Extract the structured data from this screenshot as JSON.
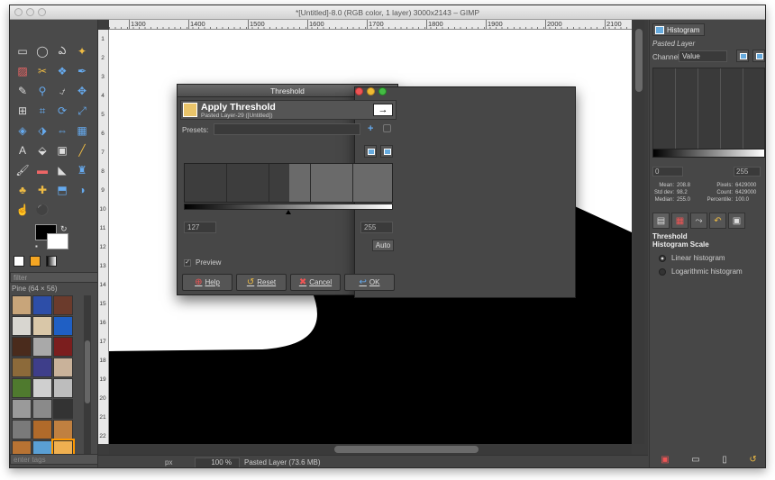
{
  "window": {
    "title": "*[Untitled]-8.0 (RGB color, 1 layer) 3000x2143 – GIMP"
  },
  "ruler": {
    "h_ticks": [
      "1300",
      "1400",
      "1500",
      "1600",
      "1700",
      "1800",
      "1900",
      "2000",
      "2100"
    ],
    "v_ticks": [
      "1",
      "2",
      "3",
      "4",
      "5",
      "6",
      "7",
      "8",
      "9",
      "10",
      "11",
      "12",
      "13",
      "14",
      "15",
      "16",
      "17",
      "18",
      "19",
      "20",
      "21",
      "22"
    ]
  },
  "toolbox": {
    "brush_filter": "filter",
    "pattern_title": "Pine (64 × 56)",
    "tag_placeholder": "enter tags",
    "tools": [
      "rect-select",
      "ellipse-select",
      "free-select",
      "fuzzy-select",
      "select-by-color",
      "scissors",
      "foreground-select",
      "paths",
      "color-picker",
      "zoom",
      "measure",
      "move",
      "align",
      "crop",
      "rotate",
      "scale",
      "shear",
      "perspective",
      "flip",
      "cage",
      "text",
      "bucket-fill",
      "blend",
      "pencil",
      "paintbrush",
      "eraser",
      "airbrush",
      "ink",
      "clone",
      "heal",
      "perspective-clone",
      "blur",
      "smudge",
      "dodge-burn"
    ],
    "tool_glyphs": [
      "▭",
      "◯",
      "ఎ",
      "✦",
      "▨",
      "✂",
      "❖",
      "✒",
      "✎",
      "⚲",
      "⍻",
      "✥",
      "⊞",
      "⌗",
      "⟳",
      "⤢",
      "◈",
      "⬗",
      "⇔",
      "▦",
      "A",
      "⬙",
      "▣",
      "╱",
      "🖌",
      "▬",
      "◣",
      "♜",
      "♣",
      "✚",
      "⬒",
      "◑",
      "☝",
      "⚫"
    ],
    "tool_colors": [
      "",
      "",
      "",
      "c3",
      "c4",
      "c3",
      "c2",
      "c2",
      "",
      "c2",
      "",
      "c2",
      "",
      "c2",
      "c2",
      "c2",
      "c2",
      "c2",
      "c2",
      "c2",
      "",
      "",
      "",
      "c3",
      "",
      "c4",
      "",
      "c2",
      "c3",
      "c3",
      "c2",
      "c2",
      "",
      "c2"
    ],
    "patterns": [
      "#c8a57a",
      "#2d4ea8",
      "#6b3b2c",
      "#d8d6d0",
      "#d9c7a8",
      "#1f5fc4",
      "#4a2b1c",
      "#a9a9a9",
      "#7b1e1e",
      "#8c6a3a",
      "#3e3e8a",
      "#c9b29a",
      "#4f7a2e",
      "#cfcfcf",
      "#bdbdbd",
      "#9a9a9a",
      "#8a8a8a",
      "#333333",
      "#7a7a7a",
      "#b06a2a",
      "#c08040",
      "#b87333",
      "#5a9fd4",
      "#f0b050"
    ]
  },
  "dialog": {
    "title": "Threshold",
    "heading": "Apply Threshold",
    "subheading": "Pasted Layer-29 ([Untitled])",
    "presets_label": "Presets:",
    "low": "127",
    "high": "255",
    "auto": "Auto",
    "preview": "Preview",
    "preview_checked": "✓",
    "buttons": {
      "help": "Help",
      "reset": "Reset",
      "cancel": "Cancel",
      "ok": "OK"
    },
    "threshold_fraction": 0.5
  },
  "histogram": {
    "tab": "Histogram",
    "layer": "Pasted Layer",
    "channel_label": "Channel:",
    "channel": "Value",
    "min": "0",
    "max": "255",
    "mean_label": "Mean:",
    "mean": "208.8",
    "std_label": "Std dev:",
    "std": "98.2",
    "median_label": "Median:",
    "median": "255.0",
    "pixels_label": "Pixels:",
    "pixels": "6429000",
    "count_label": "Count:",
    "count": "6429000",
    "percentile_label": "Percentile:",
    "percentile": "100.0"
  },
  "tool_options": {
    "title": "Threshold",
    "scale_label": "Histogram Scale",
    "linear": "Linear histogram",
    "log": "Logarithmic histogram"
  },
  "status": {
    "unit": "px",
    "zoom": "100 %",
    "message": "Pasted Layer (73.6 MB)"
  }
}
